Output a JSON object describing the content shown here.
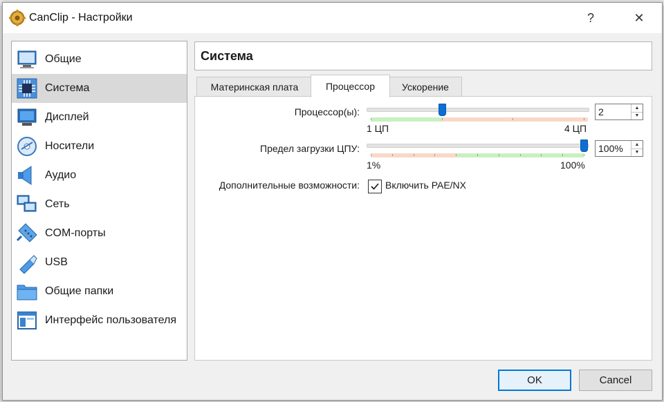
{
  "window": {
    "title": "CanClip - Настройки",
    "help_glyph": "?",
    "close_glyph": "✕"
  },
  "sidebar": {
    "items": [
      {
        "label": "Общие",
        "icon": "monitor-general-icon"
      },
      {
        "label": "Система",
        "icon": "chip-icon",
        "selected": true
      },
      {
        "label": "Дисплей",
        "icon": "display-icon"
      },
      {
        "label": "Носители",
        "icon": "disc-icon"
      },
      {
        "label": "Аудио",
        "icon": "speaker-icon"
      },
      {
        "label": "Сеть",
        "icon": "network-icon"
      },
      {
        "label": "COM-порты",
        "icon": "serial-port-icon"
      },
      {
        "label": "USB",
        "icon": "usb-icon"
      },
      {
        "label": "Общие папки",
        "icon": "folder-icon"
      },
      {
        "label": "Интерфейс пользователя",
        "icon": "window-ui-icon"
      }
    ]
  },
  "section": {
    "title": "Система"
  },
  "tabs": [
    {
      "label": "Материнская плата"
    },
    {
      "label": "Процессор",
      "active": true
    },
    {
      "label": "Ускорение"
    }
  ],
  "processor": {
    "cpu_label": "Процессор(ы):",
    "cpu_value": "2",
    "cpu_min_label": "1 ЦП",
    "cpu_max_label": "4 ЦП",
    "cpu_min": 1,
    "cpu_max": 4,
    "cpu_count": 2,
    "cap_label": "Предел загрузки ЦПУ:",
    "cap_value": "100%",
    "cap_min_label": "1%",
    "cap_max_label": "100%",
    "cap_percent": 100,
    "extended_label": "Дополнительные возможности:",
    "pae_label": "Включить PAE/NX",
    "pae_checked": true
  },
  "buttons": {
    "ok": "OK",
    "cancel": "Cancel"
  },
  "colors": {
    "selection": "#d9d9d9",
    "slider_thumb": "#0c6fd6",
    "zone_ok": "#c9f0c1",
    "zone_warn": "#f9d8c8",
    "default_button_border": "#0078d7"
  }
}
